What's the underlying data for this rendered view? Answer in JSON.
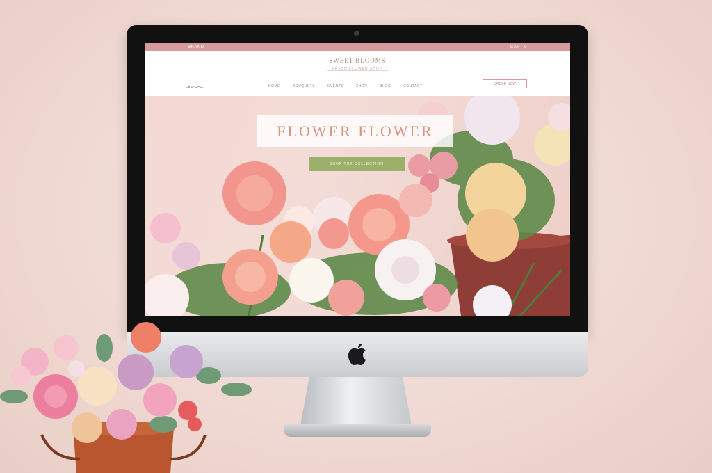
{
  "site": {
    "topbar_left": "BRAND",
    "topbar_right": "CART  0",
    "brand_name": "SWEET BLOOMS",
    "brand_tagline": "FRESH FLOWER SHOP",
    "nav": [
      "HOME",
      "BOUQUETS",
      "EVENTS",
      "SHOP",
      "BLOG",
      "CONTACT"
    ],
    "header_button": "ORDER NOW",
    "hero_title": "FLOWER FLOWER",
    "hero_cta": "SHOP THE COLLECTION"
  },
  "colors": {
    "page_bg": "#f1dcd6",
    "accent_pink": "#d79a9a",
    "title_rose": "#d79480",
    "cta_green": "#9caf6b"
  },
  "icons": [
    "apple-logo-icon",
    "camera-dot-icon",
    "flower-logo-icon"
  ]
}
